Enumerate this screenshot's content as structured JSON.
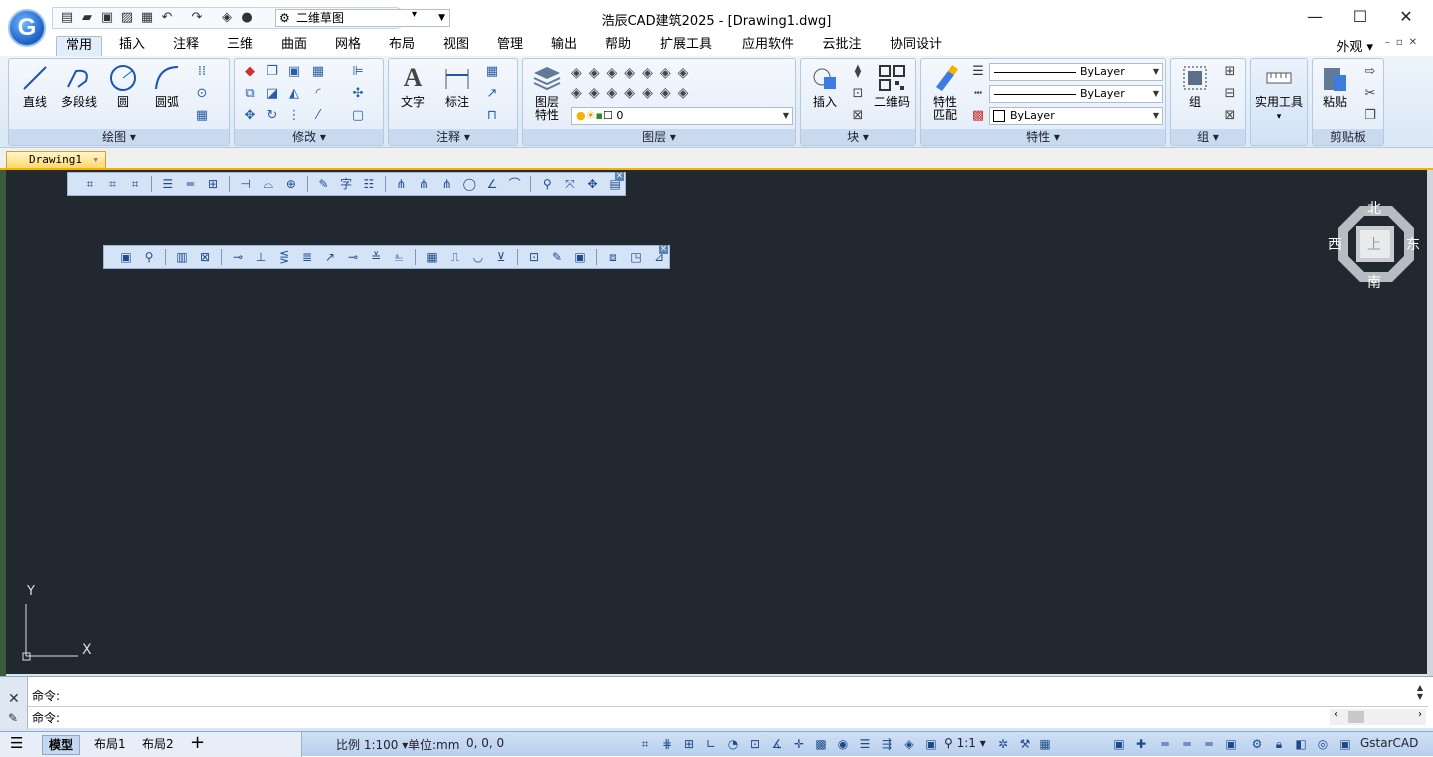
{
  "titlebar": {
    "title": "浩辰CAD建筑2025 - [Drawing1.dwg]",
    "workspace": "二维草图",
    "minimize": "—",
    "maximize": "☐",
    "close": "✕"
  },
  "tabs": [
    "常用",
    "插入",
    "注释",
    "三维",
    "曲面",
    "网格",
    "布局",
    "视图",
    "管理",
    "输出",
    "帮助",
    "扩展工具",
    "应用软件",
    "云批注",
    "协同设计"
  ],
  "appearance": "外观",
  "ribbon": {
    "draw": {
      "title": "绘图",
      "line": "直线",
      "polyline": "多段线",
      "circle": "圆",
      "arc": "圆弧"
    },
    "modify": {
      "title": "修改"
    },
    "annotation": {
      "title": "注释",
      "text": "文字",
      "dimension": "标注"
    },
    "layers": {
      "title": "图层",
      "props": "图层特性",
      "props_l1": "图层",
      "props_l2": "特性",
      "current": "0"
    },
    "block": {
      "title": "块",
      "insert": "插入",
      "qrcode": "二维码"
    },
    "properties": {
      "title": "特性",
      "match_l1": "特性",
      "match_l2": "匹配",
      "color": "ByLayer",
      "linetype": "ByLayer",
      "lineweight": "ByLayer"
    },
    "group": {
      "title": "组",
      "group": "组"
    },
    "utilities": {
      "title": "",
      "label": "实用工具"
    },
    "clipboard": {
      "title": "剪贴板",
      "paste": "粘贴"
    }
  },
  "doc_tab": "Drawing1",
  "viewcube": {
    "north": "北",
    "south": "南",
    "east": "东",
    "west": "西",
    "top": "上"
  },
  "ucs": {
    "x": "X",
    "y": "Y"
  },
  "command": {
    "line1": "命令:",
    "line2": "命令:"
  },
  "status": {
    "model": "模型",
    "layout1": "布局1",
    "layout2": "布局2",
    "scale": "比例 1:100",
    "units": "单位:mm",
    "coords": "0, 0, 0",
    "annoscale": "1:1",
    "brand": "GstarCAD"
  }
}
